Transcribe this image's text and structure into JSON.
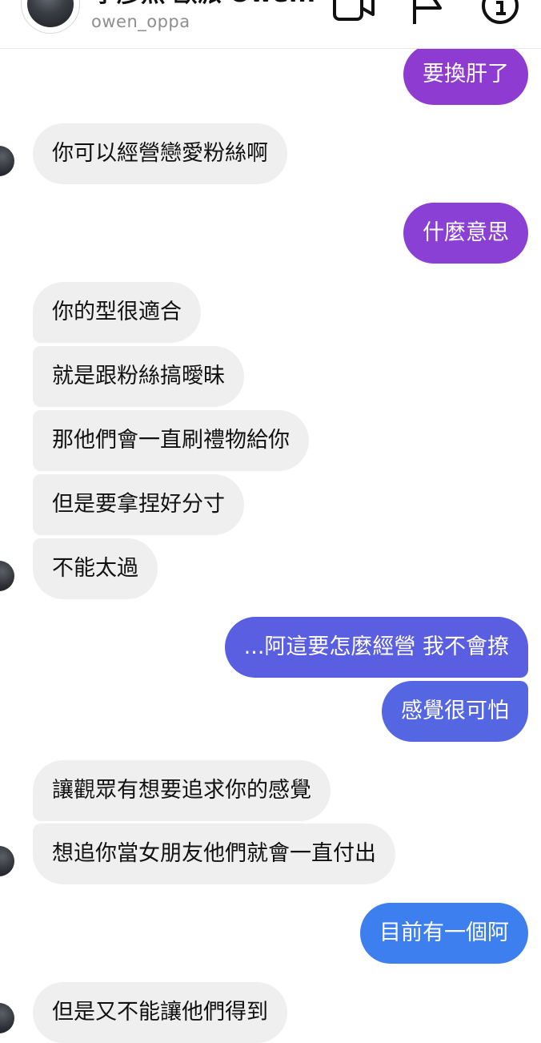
{
  "header": {
    "name": "李彥熙 歐派 Owe...",
    "username": "owen_oppa",
    "icons": [
      "video-call-icon",
      "flag-icon",
      "info-icon"
    ]
  },
  "colors": {
    "received_bubble": "#efefef",
    "sent_purple": "#8e3bd1",
    "sent_indigo": "#5a5ee0",
    "sent_blue": "#3e7ff0"
  },
  "messages": [
    {
      "side": "sent",
      "text": "要換肝了"
    },
    {
      "side": "received",
      "text": "你可以經營戀愛粉絲啊"
    },
    {
      "side": "sent",
      "text": "什麼意思"
    },
    {
      "side": "received",
      "text": "你的型很適合"
    },
    {
      "side": "received",
      "text": "就是跟粉絲搞曖昧"
    },
    {
      "side": "received",
      "text": "那他們會一直刷禮物給你"
    },
    {
      "side": "received",
      "text": "但是要拿捏好分寸"
    },
    {
      "side": "received",
      "text": "不能太過"
    },
    {
      "side": "sent",
      "text": "...阿這要怎麼經營 我不會撩"
    },
    {
      "side": "sent",
      "text": "感覺很可怕"
    },
    {
      "side": "received",
      "text": "讓觀眾有想要追求你的感覺"
    },
    {
      "side": "received",
      "text": "想追你當女朋友他們就會一直付出"
    },
    {
      "side": "sent",
      "text": "目前有一個阿"
    },
    {
      "side": "received",
      "text": "但是又不能讓他們得到"
    }
  ]
}
